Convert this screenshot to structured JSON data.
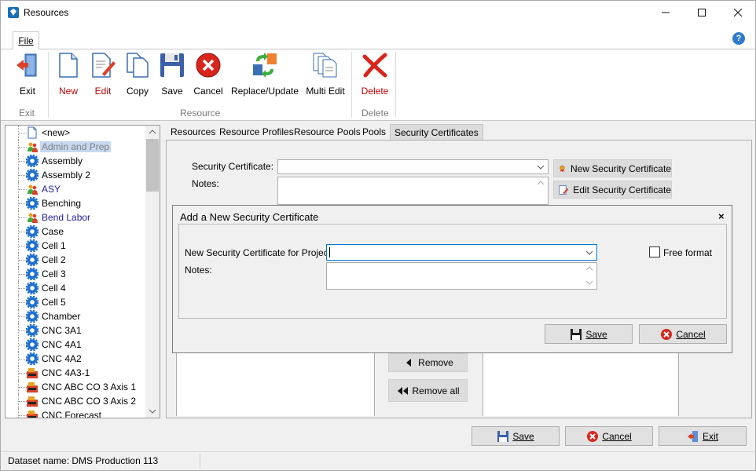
{
  "window": {
    "title": "Resources",
    "minimize": "—",
    "maximize": "☐",
    "close": "✕"
  },
  "ribbon": {
    "tab_file": "File",
    "buttons": {
      "exit": "Exit",
      "new": "New",
      "edit": "Edit",
      "copy": "Copy",
      "save": "Save",
      "cancel": "Cancel",
      "replace_update": "Replace/Update",
      "multi_edit": "Multi Edit",
      "delete": "Delete"
    },
    "groups": {
      "exit": "Exit",
      "resource": "Resource",
      "delete": "Delete"
    }
  },
  "tree": {
    "items": [
      {
        "label": "<new>",
        "icon": "new-document-icon",
        "style": "normal"
      },
      {
        "label": "Admin and Prep",
        "icon": "people-icon",
        "style": "selected"
      },
      {
        "label": "Assembly",
        "icon": "gear-icon",
        "style": "normal"
      },
      {
        "label": "Assembly 2",
        "icon": "gear-icon",
        "style": "normal"
      },
      {
        "label": "ASY",
        "icon": "people-icon",
        "style": "blue"
      },
      {
        "label": "Benching",
        "icon": "gear-icon",
        "style": "normal"
      },
      {
        "label": "Bend Labor",
        "icon": "people-icon",
        "style": "blue"
      },
      {
        "label": "Case",
        "icon": "gear-icon",
        "style": "normal"
      },
      {
        "label": "Cell 1",
        "icon": "gear-icon",
        "style": "normal"
      },
      {
        "label": "Cell 2",
        "icon": "gear-icon",
        "style": "normal"
      },
      {
        "label": "Cell 3",
        "icon": "gear-icon",
        "style": "normal"
      },
      {
        "label": "Cell 4",
        "icon": "gear-icon",
        "style": "normal"
      },
      {
        "label": "Cell 5",
        "icon": "gear-icon",
        "style": "normal"
      },
      {
        "label": "Chamber",
        "icon": "gear-icon",
        "style": "normal"
      },
      {
        "label": "CNC 3A1",
        "icon": "gear-icon",
        "style": "normal"
      },
      {
        "label": "CNC 4A1",
        "icon": "gear-icon",
        "style": "normal"
      },
      {
        "label": "CNC 4A2",
        "icon": "gear-icon",
        "style": "normal"
      },
      {
        "label": "CNC 4A3-1",
        "icon": "machine-icon",
        "style": "normal"
      },
      {
        "label": "CNC ABC CO 3 Axis 1",
        "icon": "machine-icon",
        "style": "normal"
      },
      {
        "label": "CNC ABC CO 3 Axis 2",
        "icon": "machine-icon",
        "style": "normal"
      },
      {
        "label": "CNC Forecast",
        "icon": "machine-icon",
        "style": "normal"
      }
    ]
  },
  "content_tabs": [
    "Resources",
    "Resource Profiles",
    "Resource Pools",
    "Pools",
    "Security Certificates"
  ],
  "content_tabs_active": "Security Certificates",
  "security": {
    "certificate_label": "Security Certificate:",
    "certificate_value": "",
    "notes_label": "Notes:",
    "new_cert_button": "New Security Certificate",
    "edit_cert_button": "Edit Security Certificate",
    "remove_button": "Remove",
    "remove_all_button": "Remove all"
  },
  "dialog": {
    "title": "Add a New Security Certificate",
    "close": "×",
    "project_label": "New Security Certificate for Project:",
    "project_value": "",
    "notes_label": "Notes:",
    "free_format_label": "Free format",
    "free_format_checked": false,
    "save_button": "Save",
    "cancel_button": "Cancel"
  },
  "bottom": {
    "save": "Save",
    "cancel": "Cancel",
    "exit": "Exit"
  },
  "status": {
    "dataset": "Dataset name:  DMS Production 113"
  },
  "colors": {
    "accent_blue": "#2f7ad0",
    "delete_red": "#c00000",
    "selection": "#c6d9f0"
  }
}
